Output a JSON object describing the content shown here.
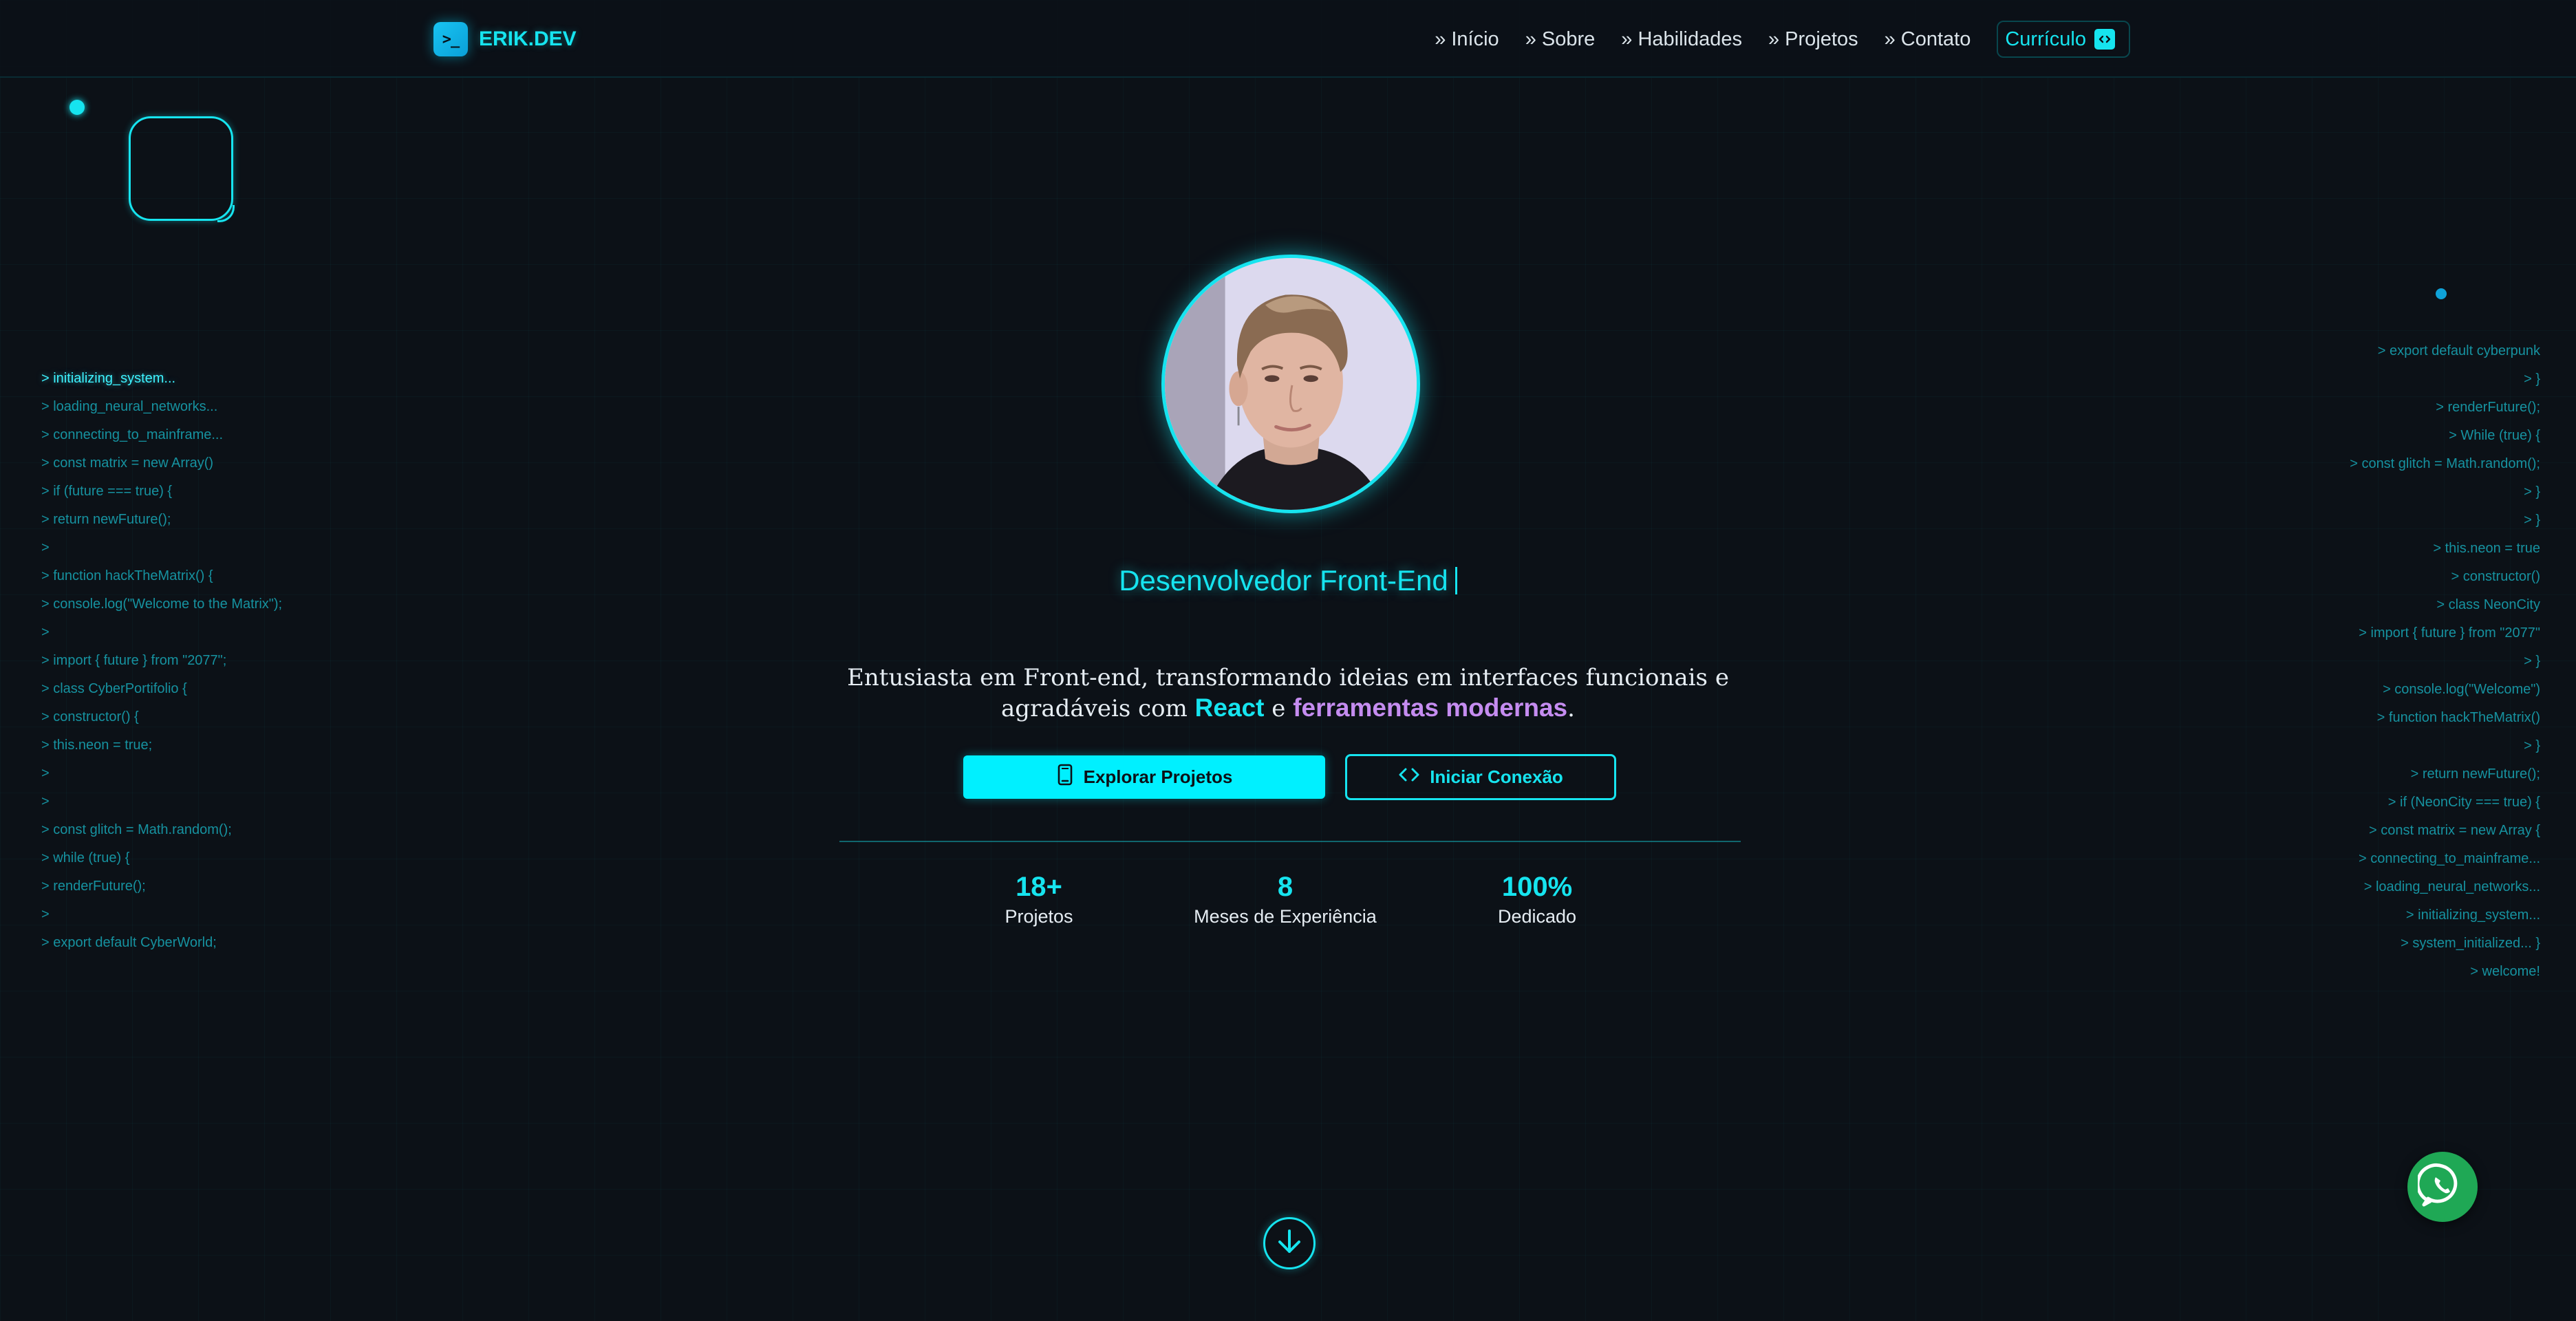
{
  "brand": {
    "logo_glyph": ">_",
    "name": "ERIK.DEV"
  },
  "nav": {
    "items": [
      {
        "label": "» Início"
      },
      {
        "label": "» Sobre"
      },
      {
        "label": "» Habilidades"
      },
      {
        "label": "» Projetos"
      },
      {
        "label": "» Contato"
      }
    ],
    "cv_label": "Currículo"
  },
  "code_left": [
    "> initializing_system...",
    "> loading_neural_networks...",
    "> connecting_to_mainframe...",
    "> const matrix = new Array()",
    "> if (future === true) {",
    "> return newFuture();",
    ">",
    "> function hackTheMatrix() {",
    "> console.log(\"Welcome to the Matrix\");",
    ">",
    "> import { future } from \"2077\";",
    "> class CyberPortifolio {",
    "> constructor() {",
    "> this.neon = true;",
    ">",
    ">",
    "> const glitch = Math.random();",
    "> while (true) {",
    "> renderFuture();",
    ">",
    "> export default CyberWorld;"
  ],
  "code_right": [
    "> export default cyberpunk",
    "> }",
    "> renderFuture();",
    "> While (true) {",
    "> const glitch = Math.random();",
    "> }",
    "> }",
    "> this.neon = true",
    "> constructor()",
    "> class NeonCity",
    "> import { future } from \"2077\"",
    "> }",
    "> console.log(\"Welcome\")",
    "> function hackTheMatrix()",
    "> }",
    "> return newFuture();",
    "> if (NeonCity === true) {",
    "> const matrix = new Array {",
    "> connecting_to_mainframe...",
    "> loading_neural_networks...",
    "> initializing_system...",
    "> system_initialized... }",
    "> welcome!"
  ],
  "hero": {
    "role": "Desenvolvedor Front-End",
    "intro_before": "Entusiasta em Front-end, transformando ideias em interfaces funcionais e agradáveis com ",
    "intro_highlight_1": "React",
    "intro_connector": " e ",
    "intro_highlight_2": "ferramentas modernas",
    "intro_after": ".",
    "primary_button": "Explorar Projetos",
    "secondary_button": "Iniciar Conexão"
  },
  "stats": [
    {
      "value": "18+",
      "label": "Projetos"
    },
    {
      "value": "8",
      "label": "Meses de Experiência"
    },
    {
      "value": "100%",
      "label": "Dedicado"
    }
  ],
  "icons": {
    "logo": "terminal-icon",
    "cv": "document-code-icon",
    "primary_button": "tablet-icon",
    "secondary_button": "code-brackets-icon",
    "scroll": "arrow-down-icon",
    "whatsapp": "whatsapp-icon"
  },
  "colors": {
    "background": "#0c1117",
    "accent": "#16e4ef",
    "accent_purple": "#c58cf0",
    "whatsapp": "#1fa855"
  }
}
